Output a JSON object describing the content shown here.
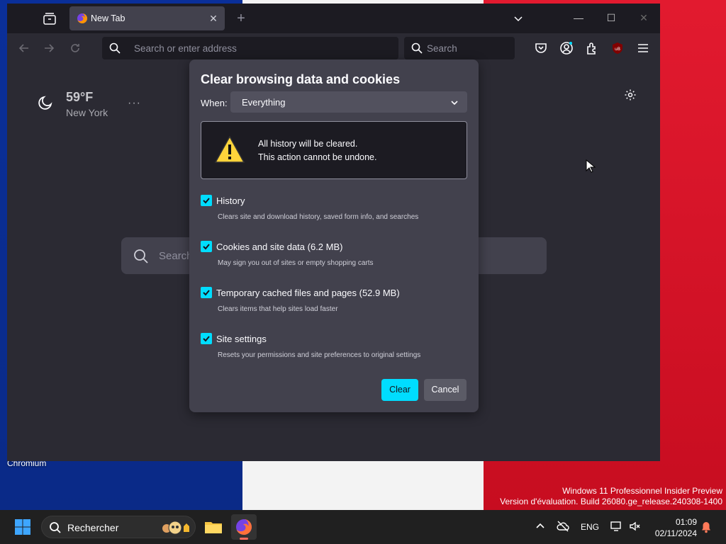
{
  "desktop": {
    "icon_label": "Chromium",
    "watermark_line1": "Windows 11 Professionnel Insider Preview",
    "watermark_line2": "Version d'évaluation. Build 26080.ge_release.240308-1400",
    "colors": {
      "flag_blue": "#0a2f99",
      "flag_white": "#f3f3f3",
      "flag_red": "#e21a2f"
    }
  },
  "browser": {
    "tab_title": "New Tab",
    "url_placeholder": "Search or enter address",
    "search_placeholder": "Search",
    "extension_badge": "uB",
    "weather": {
      "temp": "59°F",
      "city": "New York",
      "more": "···"
    },
    "newtab_search_placeholder": "Search"
  },
  "dialog": {
    "title": "Clear browsing data and cookies",
    "when_label": "When:",
    "when_value": "Everything",
    "warning_line1": "All history will be cleared.",
    "warning_line2": "This action cannot be undone.",
    "options": [
      {
        "label": "History",
        "description": "Clears site and download history, saved form info, and searches",
        "checked": true
      },
      {
        "label": "Cookies and site data (6.2 MB)",
        "description": "May sign you out of sites or empty shopping carts",
        "checked": true
      },
      {
        "label": "Temporary cached files and pages (52.9 MB)",
        "description": "Clears items that help sites load faster",
        "checked": true
      },
      {
        "label": "Site settings",
        "description": "Resets your permissions and site preferences to original settings",
        "checked": true
      }
    ],
    "clear_label": "Clear",
    "cancel_label": "Cancel",
    "accent_color": "#00ddff"
  },
  "taskbar": {
    "search_placeholder": "Rechercher",
    "language": "ENG",
    "time": "01:09",
    "date": "02/11/2024"
  }
}
